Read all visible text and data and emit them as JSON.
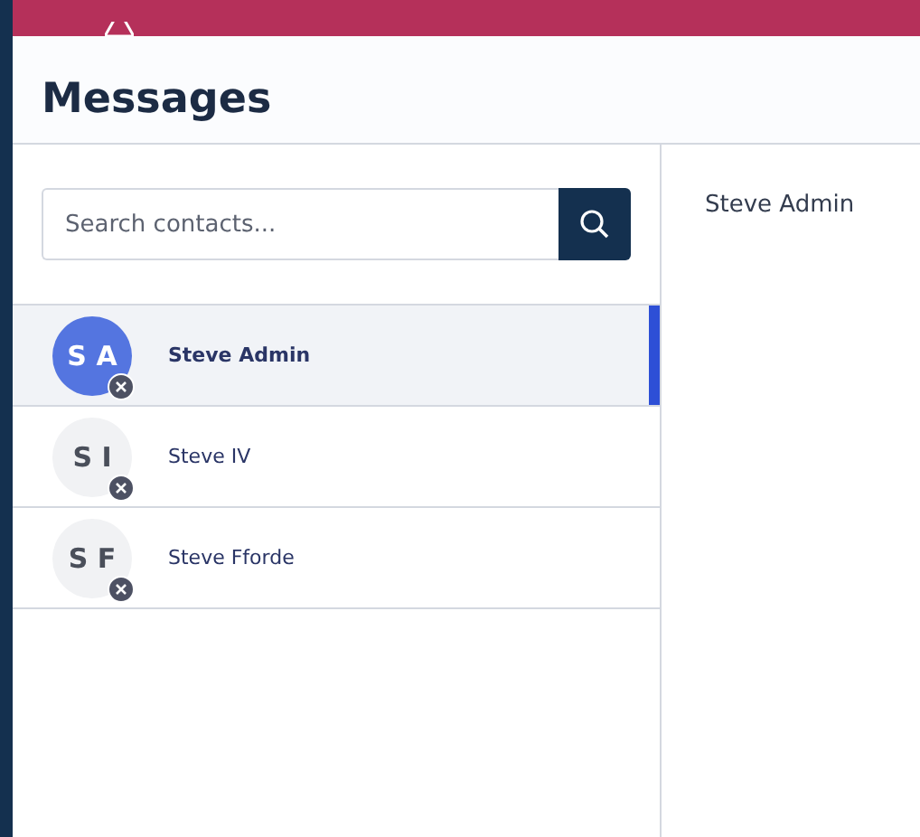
{
  "page": {
    "title": "Messages"
  },
  "search": {
    "placeholder": "Search contacts..."
  },
  "contacts": [
    {
      "initials": "S A",
      "name": "Steve Admin",
      "selected": true
    },
    {
      "initials": "S I",
      "name": "Steve IV",
      "selected": false
    },
    {
      "initials": "S F",
      "name": "Steve Fforde",
      "selected": false
    }
  ],
  "conversation": {
    "contact_name": "Steve Admin"
  }
}
